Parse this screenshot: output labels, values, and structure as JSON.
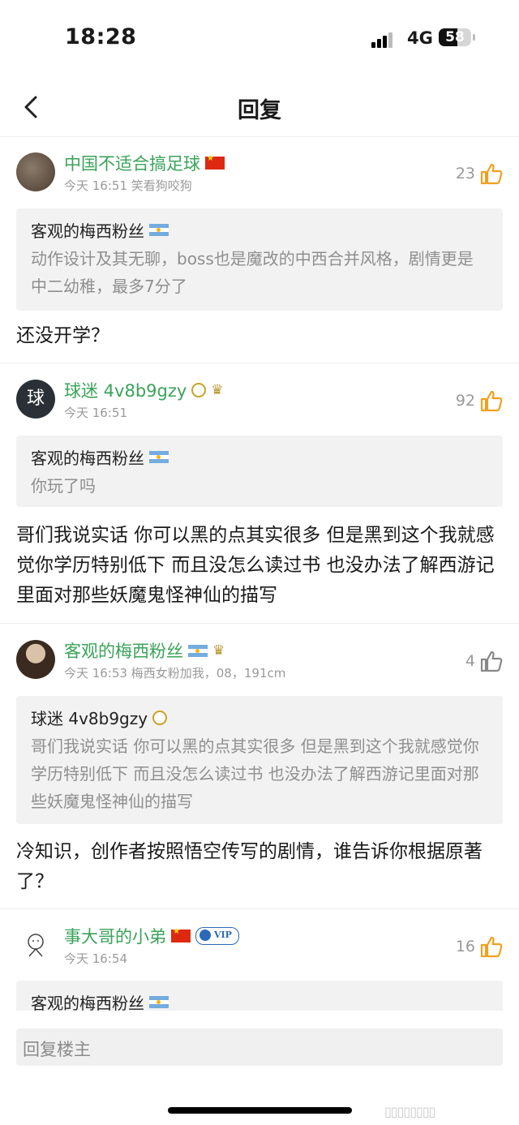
{
  "status_bar": {
    "time": "18:28",
    "network": "4G",
    "battery": "58",
    "battery_level": 0.58
  },
  "nav": {
    "title": "回复",
    "back_icon": "chevron-left-icon"
  },
  "comments": [
    {
      "username": "中国不适合搞足球",
      "meta": "今天 16:51 笑看狗咬狗",
      "likes": "23",
      "liked": true,
      "quote_user": "客观的梅西粉丝",
      "quote_text": "动作设计及其无聊，boss也是魔改的中西合并风格，剧情更是中二幼稚，最多7分了",
      "body": "还没开学？"
    },
    {
      "username": "球迷 4v8b9gzy",
      "avatar_text": "球",
      "meta": "今天 16:51",
      "likes": "92",
      "liked": true,
      "quote_user": "客观的梅西粉丝",
      "quote_text": "你玩了吗",
      "body": "哥们我说实话 你可以黑的点其实很多 但是黑到这个我就感觉你学历特别低下 而且没怎么读过书 也没办法了解西游记里面对那些妖魔鬼怪神仙的描写"
    },
    {
      "username": "客观的梅西粉丝",
      "meta": "今天 16:53 梅西女粉加我，08，191cm",
      "likes": "4",
      "liked": false,
      "quote_user": "球迷 4v8b9gzy",
      "quote_text": "哥们我说实话 你可以黑的点其实很多 但是黑到这个我就感觉你学历特别低下 而且没怎么读过书 也没办法了解西游记里面对那些妖魔鬼怪神仙的描写",
      "body": "冷知识，创作者按照悟空传写的剧情，谁告诉你根据原著了？"
    },
    {
      "username": "事大哥的小弟",
      "meta": "今天 16:54",
      "likes": "16",
      "liked": true,
      "vip_label": "VIP",
      "quote_user": "客观的梅西粉丝"
    }
  ],
  "reply_bar": {
    "placeholder": "回复楼主"
  },
  "colors": {
    "username": "#3aa35a",
    "like_active": "#f0a020",
    "like_inactive": "#888888"
  },
  "icons": {
    "like": "thumbs-up-icon"
  }
}
